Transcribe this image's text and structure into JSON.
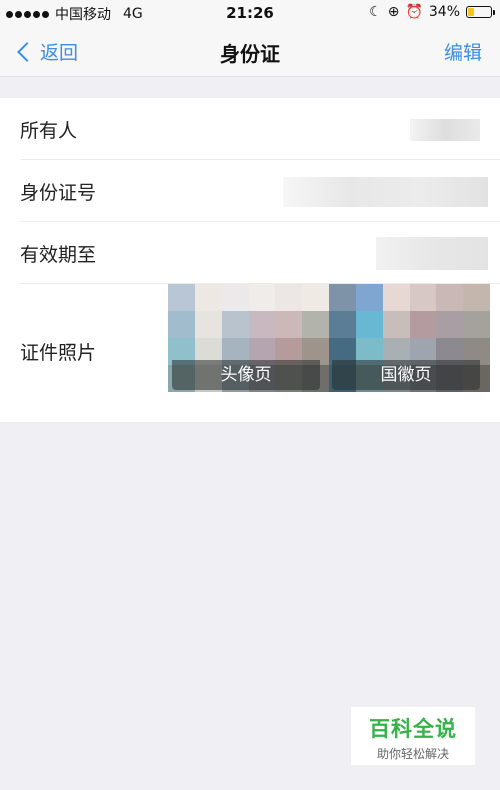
{
  "status_bar": {
    "carrier": "中国移动",
    "network": "4G",
    "time": "21:26",
    "battery": "34%",
    "battery_level": 0.34,
    "battery_color": "#f5c518"
  },
  "nav": {
    "back_label": "返回",
    "title": "身份证",
    "edit_label": "编辑",
    "accent_color": "#3a8ee6"
  },
  "rows": [
    {
      "label": "所有人"
    },
    {
      "label": "身份证号"
    },
    {
      "label": "有效期至"
    },
    {
      "label": "证件照片"
    }
  ],
  "photos": {
    "front_label": "头像页",
    "back_label": "国徽页"
  },
  "watermark": {
    "title": "百科全说",
    "subtitle": "助你轻松解决"
  }
}
